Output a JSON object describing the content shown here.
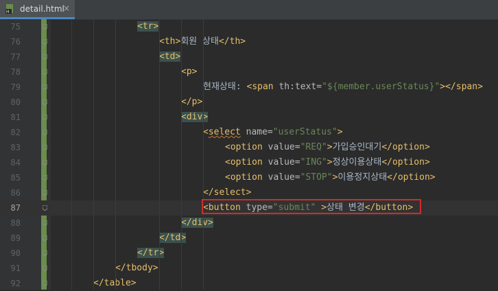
{
  "tab": {
    "filename": "detail.html",
    "close": "×"
  },
  "lines": [
    {
      "num": "75",
      "indent": 0,
      "parts": [
        [
          "br",
          "<"
        ],
        [
          "tag",
          "tr"
        ],
        [
          "br",
          ">"
        ]
      ],
      "hl": true
    },
    {
      "num": "76",
      "indent": 1,
      "parts": [
        [
          "br",
          "<"
        ],
        [
          "tag",
          "th"
        ],
        [
          "br",
          ">"
        ],
        [
          "txt",
          "회원 상태"
        ],
        [
          "br",
          "</"
        ],
        [
          "tag",
          "th"
        ],
        [
          "br",
          ">"
        ]
      ]
    },
    {
      "num": "77",
      "indent": 1,
      "parts": [
        [
          "br",
          "<"
        ],
        [
          "tag",
          "td"
        ],
        [
          "br",
          ">"
        ]
      ],
      "hl": true
    },
    {
      "num": "78",
      "indent": 2,
      "parts": [
        [
          "br",
          "<"
        ],
        [
          "tag",
          "p"
        ],
        [
          "br",
          ">"
        ]
      ]
    },
    {
      "num": "79",
      "indent": 3,
      "parts": [
        [
          "txt",
          "현재상태: "
        ],
        [
          "br",
          "<"
        ],
        [
          "tag",
          "span "
        ],
        [
          "attr",
          "th:text="
        ],
        [
          "val",
          "\"${member.userStatus}\""
        ],
        [
          "br",
          "></"
        ],
        [
          "tag",
          "span"
        ],
        [
          "br",
          ">"
        ]
      ]
    },
    {
      "num": "80",
      "indent": 2,
      "parts": [
        [
          "br",
          "</"
        ],
        [
          "tag",
          "p"
        ],
        [
          "br",
          ">"
        ]
      ]
    },
    {
      "num": "81",
      "indent": 2,
      "parts": [
        [
          "br",
          "<"
        ],
        [
          "tag",
          "div"
        ],
        [
          "br",
          ">"
        ]
      ],
      "hl": true
    },
    {
      "num": "82",
      "indent": 3,
      "parts": [
        [
          "br",
          "<"
        ],
        [
          "tagsq",
          "select"
        ],
        [
          "attr",
          " name="
        ],
        [
          "val",
          "\"userStatus\""
        ],
        [
          "br",
          ">"
        ]
      ]
    },
    {
      "num": "83",
      "indent": 4,
      "parts": [
        [
          "br",
          "<"
        ],
        [
          "tag",
          "option "
        ],
        [
          "attr",
          "value="
        ],
        [
          "val",
          "\"REQ\""
        ],
        [
          "br",
          ">"
        ],
        [
          "txt",
          "가입승인대기"
        ],
        [
          "br",
          "</"
        ],
        [
          "tag",
          "option"
        ],
        [
          "br",
          ">"
        ]
      ]
    },
    {
      "num": "84",
      "indent": 4,
      "parts": [
        [
          "br",
          "<"
        ],
        [
          "tag",
          "option "
        ],
        [
          "attr",
          "value="
        ],
        [
          "val",
          "\"ING\""
        ],
        [
          "br",
          ">"
        ],
        [
          "txt",
          "정상이용상태"
        ],
        [
          "br",
          "</"
        ],
        [
          "tag",
          "option"
        ],
        [
          "br",
          ">"
        ]
      ]
    },
    {
      "num": "85",
      "indent": 4,
      "parts": [
        [
          "br",
          "<"
        ],
        [
          "tag",
          "option "
        ],
        [
          "attr",
          "value="
        ],
        [
          "val",
          "\"STOP\""
        ],
        [
          "br",
          ">"
        ],
        [
          "txt",
          "이용정지상태"
        ],
        [
          "br",
          "</"
        ],
        [
          "tag",
          "option"
        ],
        [
          "br",
          ">"
        ]
      ]
    },
    {
      "num": "86",
      "indent": 3,
      "parts": [
        [
          "br",
          "</"
        ],
        [
          "tag",
          "select"
        ],
        [
          "br",
          ">"
        ]
      ]
    },
    {
      "num": "87",
      "indent": 3,
      "parts": [
        [
          "br",
          "<"
        ],
        [
          "tag",
          "button "
        ],
        [
          "attr",
          "type="
        ],
        [
          "val",
          "\"submit\""
        ],
        [
          "br",
          " >"
        ],
        [
          "txt",
          "상태 변경"
        ],
        [
          "br",
          "</"
        ],
        [
          "tag",
          "button"
        ],
        [
          "br",
          ">"
        ]
      ],
      "current": true
    },
    {
      "num": "88",
      "indent": 2,
      "parts": [
        [
          "br",
          "</"
        ],
        [
          "tag",
          "div"
        ],
        [
          "br",
          ">"
        ]
      ],
      "hl": true
    },
    {
      "num": "89",
      "indent": 1,
      "parts": [
        [
          "br",
          "</"
        ],
        [
          "tag",
          "td"
        ],
        [
          "br",
          ">"
        ]
      ],
      "hl": true
    },
    {
      "num": "90",
      "indent": 0,
      "parts": [
        [
          "br",
          "</"
        ],
        [
          "tag",
          "tr"
        ],
        [
          "br",
          ">"
        ]
      ],
      "hl": true
    },
    {
      "num": "91",
      "indent": -1,
      "parts": [
        [
          "br",
          "</"
        ],
        [
          "tag",
          "tbody"
        ],
        [
          "br",
          ">"
        ]
      ]
    },
    {
      "num": "92",
      "indent": -2,
      "parts": [
        [
          "br",
          "</"
        ],
        [
          "tag",
          "table"
        ],
        [
          "br",
          ">"
        ]
      ]
    }
  ]
}
